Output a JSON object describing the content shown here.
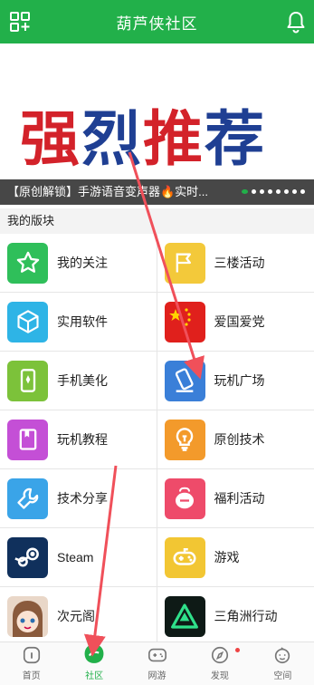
{
  "header": {
    "title": "葫芦侠社区"
  },
  "banner": {
    "big_text": [
      "强",
      "烈",
      "推",
      "荐"
    ],
    "caption": "【原创解锁】手游语音变声器🔥实时..."
  },
  "section": {
    "title": "我的版块"
  },
  "boards": [
    [
      {
        "label": "我的关注",
        "icon": "star-icon",
        "color": "#2fbf5a"
      },
      {
        "label": "三楼活动",
        "icon": "flag-icon",
        "color": "#f3c93a"
      }
    ],
    [
      {
        "label": "实用软件",
        "icon": "cube-icon",
        "color": "#2eb4e6"
      },
      {
        "label": "爱国爱党",
        "icon": "china-flag-icon",
        "color": "#e0201c"
      }
    ],
    [
      {
        "label": "手机美化",
        "icon": "phone-icon",
        "color": "#7cc23a"
      },
      {
        "label": "玩机广场",
        "icon": "tilted-phone-icon",
        "color": "#3a7fd8"
      }
    ],
    [
      {
        "label": "玩机教程",
        "icon": "book-icon",
        "color": "#c44fd6"
      },
      {
        "label": "原创技术",
        "icon": "bulb-icon",
        "color": "#f39a2b"
      }
    ],
    [
      {
        "label": "技术分享",
        "icon": "wrench-icon",
        "color": "#3aa4e8"
      },
      {
        "label": "福利活动",
        "icon": "gift-bag-icon",
        "color": "#ee4b6a"
      }
    ],
    [
      {
        "label": "Steam",
        "icon": "steam-icon",
        "color": "#10305c"
      },
      {
        "label": "游戏",
        "icon": "gamepad-icon",
        "color": "#f2c633"
      }
    ],
    [
      {
        "label": "次元阁",
        "icon": "anime-avatar-icon",
        "color": "#e9d7c8"
      },
      {
        "label": "三角洲行动",
        "icon": "delta-icon",
        "color": "#0e1a16"
      }
    ]
  ],
  "tabs": [
    {
      "label": "首页",
      "icon": "home-icon"
    },
    {
      "label": "社区",
      "icon": "community-icon"
    },
    {
      "label": "网游",
      "icon": "gamepad-icon"
    },
    {
      "label": "发现",
      "icon": "compass-icon"
    },
    {
      "label": "空间",
      "icon": "face-icon"
    }
  ],
  "colors": {
    "brand": "#22b04a",
    "annotation_arrow": "#f0505a"
  }
}
